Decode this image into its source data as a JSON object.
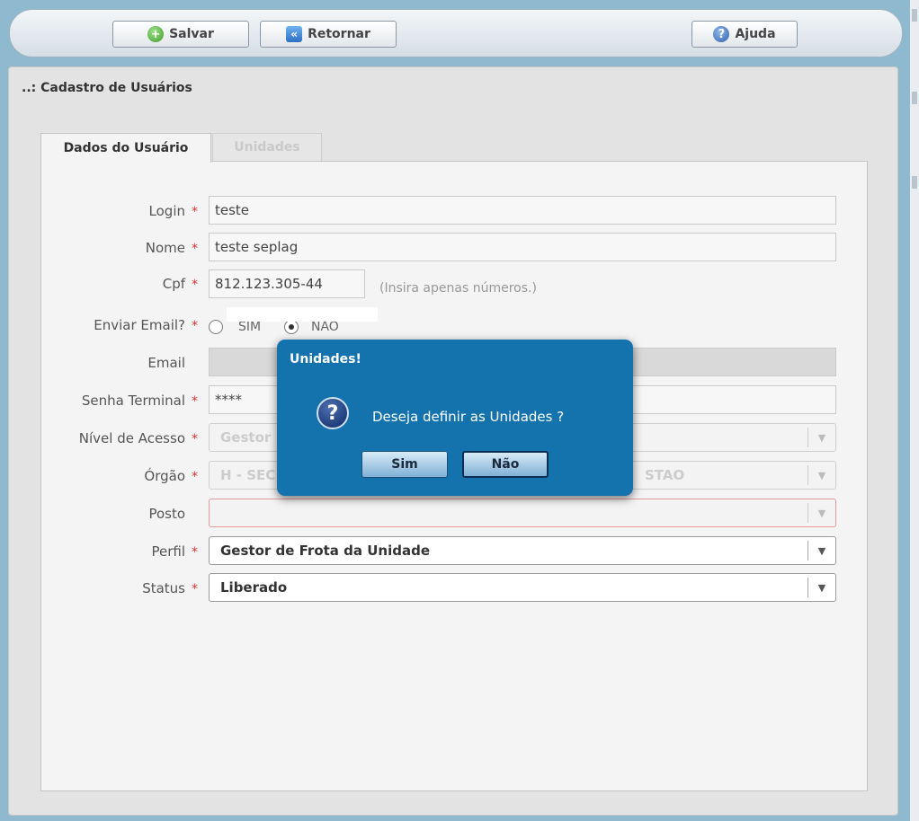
{
  "toolbar": {
    "save_label": "Salvar",
    "back_label": "Retornar",
    "help_label": "Ajuda"
  },
  "page": {
    "title": "..: Cadastro de Usuários"
  },
  "tabs": [
    {
      "label": "Dados do Usuário",
      "active": true
    },
    {
      "label": "Unidades",
      "active": false
    }
  ],
  "form": {
    "login": {
      "label": "Login",
      "value": "teste"
    },
    "nome": {
      "label": "Nome",
      "value": "teste seplag"
    },
    "cpf": {
      "label": "Cpf",
      "value": "812.123.305-44",
      "hint": "(Insira apenas números.)"
    },
    "enviar_email": {
      "label": "Enviar Email?",
      "options": [
        "SIM",
        "NAO"
      ],
      "selected": "NAO"
    },
    "email": {
      "label": "Email",
      "value": ""
    },
    "senha_terminal": {
      "label": "Senha Terminal",
      "value": "****"
    },
    "nivel_acesso": {
      "label": "Nível de Acesso",
      "value": "Gestor"
    },
    "orgao": {
      "label": "Órgão",
      "value_left": "H - SEC",
      "value_right": "STAO"
    },
    "posto": {
      "label": "Posto",
      "value": ""
    },
    "perfil": {
      "label": "Perfil",
      "value": "Gestor de Frota da Unidade"
    },
    "status": {
      "label": "Status",
      "value": "Liberado"
    },
    "required_mark": "*"
  },
  "dialog": {
    "title": "Unidades!",
    "message": "Deseja definir as Unidades ?",
    "icon": "question-icon",
    "yes_label": "Sim",
    "no_label": "Não"
  },
  "colors": {
    "dialog_bg": "#1473ad",
    "required": "#dd3333",
    "frame": "#8fb9cf"
  }
}
